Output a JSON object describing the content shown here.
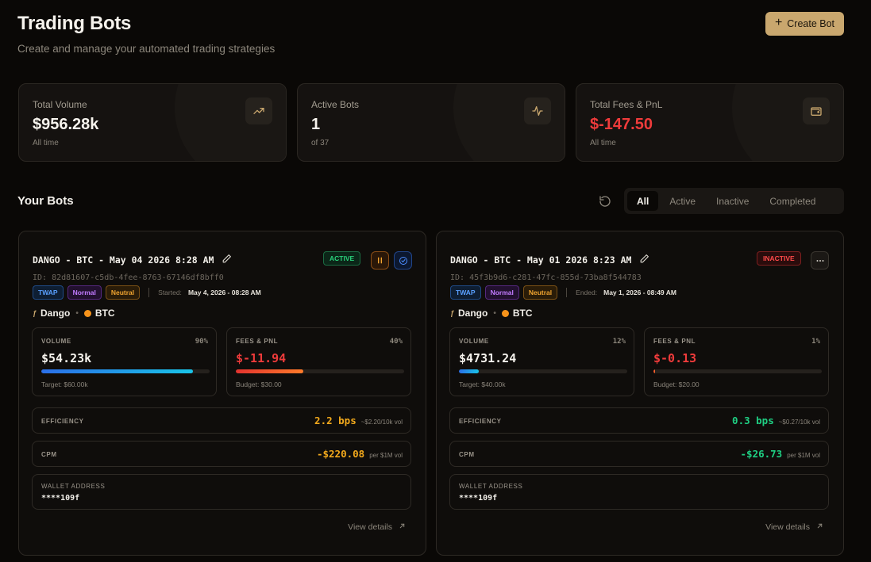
{
  "header": {
    "title": "Trading Bots",
    "subtitle": "Create and manage your automated trading strategies",
    "create_button": "Create Bot"
  },
  "stats": [
    {
      "label": "Total Volume",
      "value": "$956.28k",
      "sub": "All time",
      "icon": "trending-up-icon"
    },
    {
      "label": "Active Bots",
      "value": "1",
      "sub": "of 37",
      "icon": "activity-icon"
    },
    {
      "label": "Total Fees & PnL",
      "value": "$-147.50",
      "sub": "All time",
      "icon": "wallet-icon",
      "value_color": "#ef3b3b"
    }
  ],
  "section": {
    "title": "Your Bots",
    "filters": [
      "All",
      "Active",
      "Inactive",
      "Completed"
    ],
    "selected_filter": "All"
  },
  "bots": [
    {
      "name": "DANGO - BTC - May 04 2026 8:28 AM",
      "id": "ID: 82d81607-c5db-4fee-8763-67146df8bff0",
      "status": "ACTIVE",
      "tags": [
        "TWAP",
        "Normal",
        "Neutral"
      ],
      "date_label": "Started:",
      "date_value": "May 4, 2026 - 08:28 AM",
      "base": "Dango",
      "quote": "BTC",
      "volume": {
        "label": "VOLUME",
        "pct": "90%",
        "progress": 0.9,
        "value": "$54.23k",
        "target": "Target: $60.00k"
      },
      "fees": {
        "label": "FEES & PNL",
        "pct": "40%",
        "progress": 0.4,
        "value": "$-11.94",
        "budget": "Budget: $30.00"
      },
      "efficiency": {
        "label": "EFFICIENCY",
        "value": "2.2 bps",
        "unit": "~$2.20/10k vol",
        "color": "#f2a91c"
      },
      "cpm": {
        "label": "CPM",
        "value": "-$220.08",
        "unit": "per $1M vol",
        "color": "#f2a91c"
      },
      "wallet": {
        "label": "WALLET ADDRESS",
        "value": "****109f"
      },
      "view_details": "View details"
    },
    {
      "name": "DANGO - BTC - May 01 2026 8:23 AM",
      "id": "ID: 45f3b9d6-c281-47fc-855d-73ba8f544783",
      "status": "INACTIVE",
      "tags": [
        "TWAP",
        "Normal",
        "Neutral"
      ],
      "date_label": "Ended:",
      "date_value": "May 1, 2026 - 08:49 AM",
      "base": "Dango",
      "quote": "BTC",
      "volume": {
        "label": "VOLUME",
        "pct": "12%",
        "progress": 0.12,
        "value": "$4731.24",
        "target": "Target: $40.00k"
      },
      "fees": {
        "label": "FEES & PNL",
        "pct": "1%",
        "progress": 0.01,
        "value": "$-0.13",
        "budget": "Budget: $20.00"
      },
      "efficiency": {
        "label": "EFFICIENCY",
        "value": "0.3 bps",
        "unit": "~$0.27/10k vol",
        "color": "#1fcf83"
      },
      "cpm": {
        "label": "CPM",
        "value": "-$26.73",
        "unit": "per $1M vol",
        "color": "#1fcf83"
      },
      "wallet": {
        "label": "WALLET ADDRESS",
        "value": "****109f"
      },
      "view_details": "View details"
    }
  ]
}
